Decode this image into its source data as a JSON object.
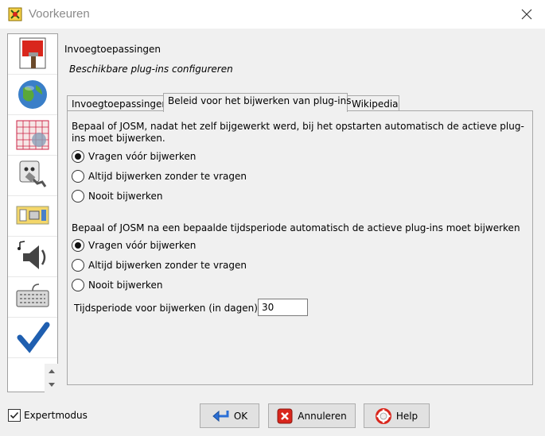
{
  "window": {
    "title": "Voorkeuren"
  },
  "sidebar": {
    "items": [
      {
        "icon": "paintbrush-preferences-icon"
      },
      {
        "icon": "globe-icon"
      },
      {
        "icon": "map-grid-icon"
      },
      {
        "icon": "plug-icon",
        "selected": true
      },
      {
        "icon": "toolbar-icon"
      },
      {
        "icon": "audio-icon"
      },
      {
        "icon": "keyboard-icon"
      },
      {
        "icon": "checkmark-icon"
      }
    ]
  },
  "panel": {
    "title": "Invoegtoepassingen",
    "subtitle": "Beschikbare plug-ins configureren"
  },
  "tabs": [
    {
      "label": "Invoegtoepassingen",
      "active": false
    },
    {
      "label": "Beleid voor het bijwerken van plug-ins",
      "active": true
    },
    {
      "label": "Wikipedia",
      "active": false
    }
  ],
  "policy": {
    "group1": {
      "label": "Bepaal of JOSM, nadat het zelf bijgewerkt werd, bij het opstarten automatisch de actieve plug-ins moet bijwerken.",
      "options": [
        "Vragen vóór bijwerken",
        "Altijd bijwerken zonder te vragen",
        "Nooit bijwerken"
      ],
      "selected": 0
    },
    "group2": {
      "label": "Bepaal of JOSM na een bepaalde tijdsperiode automatisch de actieve plug-ins moet bijwerken",
      "options": [
        "Vragen vóór bijwerken",
        "Altijd bijwerken zonder te vragen",
        "Nooit bijwerken"
      ],
      "selected": 0
    },
    "period": {
      "label": "Tijdsperiode voor bijwerken (in dagen):",
      "value": "30"
    }
  },
  "footer": {
    "expert_label": "Expertmodus",
    "expert_checked": true,
    "ok_label": "OK",
    "cancel_label": "Annuleren",
    "help_label": "Help"
  },
  "colors": {
    "accent": "#2a6fd6",
    "cancel_red": "#d9261c"
  }
}
